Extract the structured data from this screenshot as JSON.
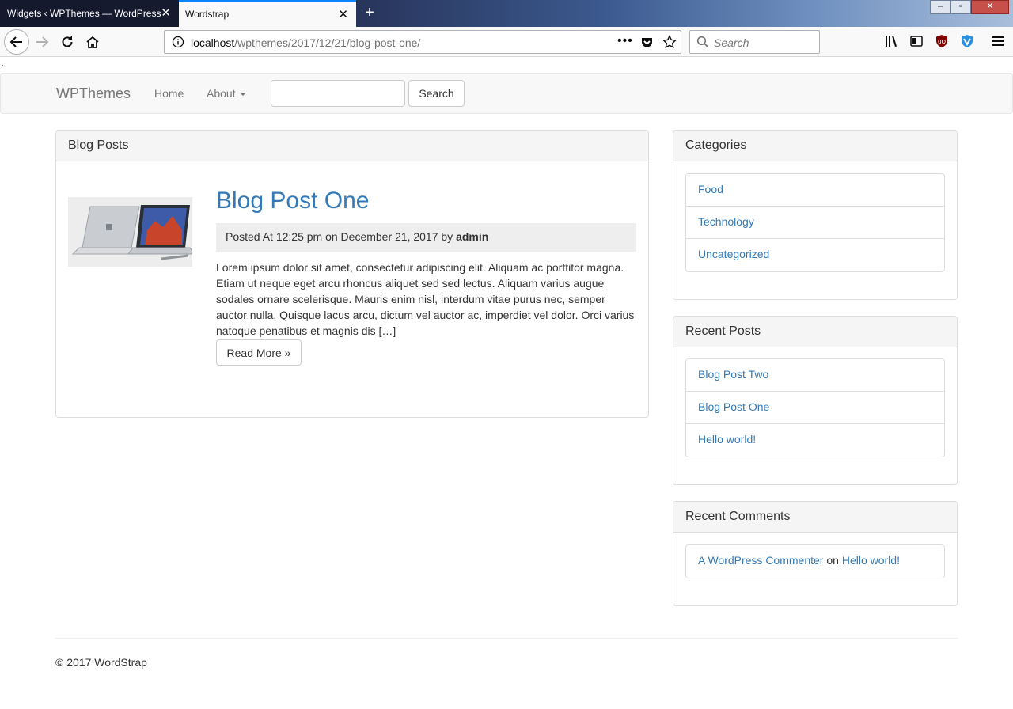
{
  "browser": {
    "tabs": [
      {
        "title": "Widgets ‹ WPThemes — WordPress",
        "active": false
      },
      {
        "title": "Wordstrap",
        "active": true
      }
    ],
    "new_tab_icon": "plus-icon",
    "url_host": "localhost",
    "url_path": "/wpthemes/2017/12/21/blog-post-one/",
    "url_more": "•••",
    "search_placeholder": "Search",
    "accent_color": "#0a84ff"
  },
  "site": {
    "brand": "WPThemes",
    "nav": {
      "home": "Home",
      "about": "About"
    },
    "search_button": "Search"
  },
  "main": {
    "panel_title": "Blog Posts",
    "post": {
      "title": "Blog Post One",
      "meta_prefix": "Posted At 12:25 pm on December 21, 2017 by",
      "author": "admin",
      "excerpt": "Lorem ipsum dolor sit amet, consectetur adipiscing elit. Aliquam ac porttitor magna. Etiam ut neque eget arcu rhoncus aliquet sed sed lectus. Aliquam varius augue sodales ornare scelerisque. Mauris enim nisl, interdum vitae purus nec, semper auctor nulla. Quisque lacus arcu, dictum vel auctor ac, imperdiet vel dolor. Orci varius natoque penatibus et magnis dis […]",
      "read_more": "Read More »"
    }
  },
  "sidebar": {
    "categories": {
      "title": "Categories",
      "items": [
        "Food",
        "Technology",
        "Uncategorized"
      ]
    },
    "recent_posts": {
      "title": "Recent Posts",
      "items": [
        "Blog Post Two",
        "Blog Post One",
        "Hello world!"
      ]
    },
    "recent_comments": {
      "title": "Recent Comments",
      "items": [
        {
          "author": "A WordPress Commenter",
          "on": "on",
          "post": "Hello world!"
        }
      ]
    }
  },
  "footer": {
    "text": "© 2017 WordStrap"
  },
  "colors": {
    "link": "#337ab7",
    "panel_heading_bg": "#f5f5f5",
    "navbar_bg": "#f8f8f8"
  }
}
